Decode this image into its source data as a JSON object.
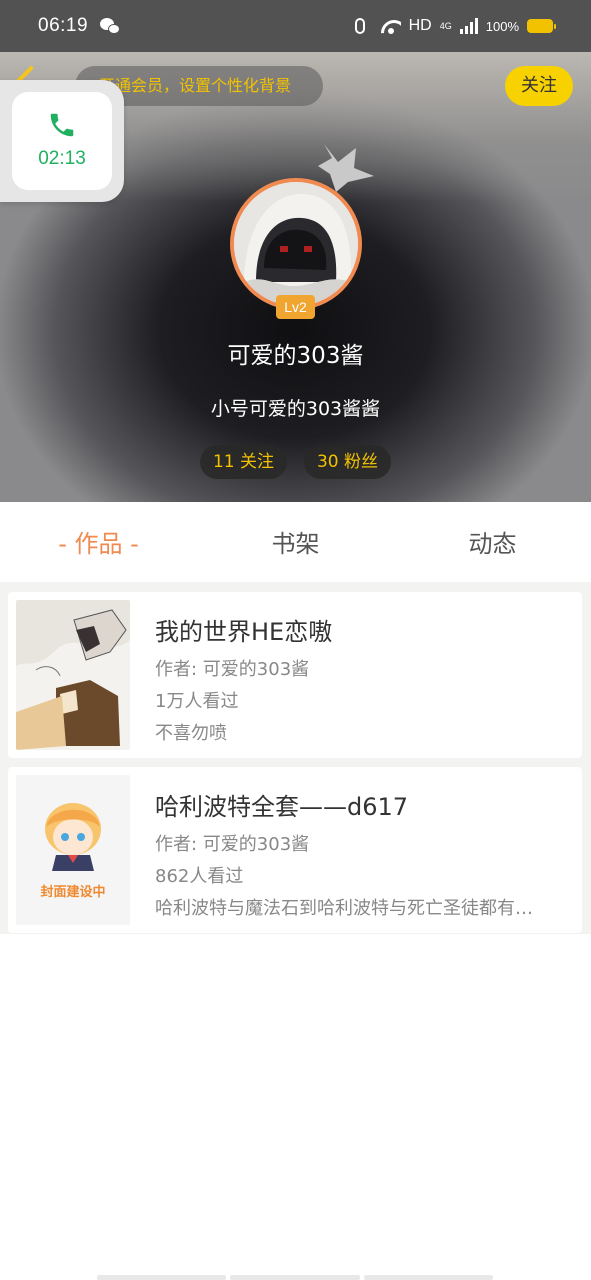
{
  "status_bar": {
    "time": "06:19",
    "network": "HD",
    "signal_type": "4G",
    "battery": "100%",
    "battery_color": "#f2c200"
  },
  "header": {
    "vip_banner": "开通会员，设置个性化背景",
    "follow_label": "关注",
    "accent_color": "#f7d100"
  },
  "call_widget": {
    "timer": "02:13",
    "icon": "phone-icon",
    "color": "#20b060"
  },
  "profile": {
    "level": "Lv2",
    "username": "可爱的303酱",
    "bio": "小号可爱的303酱酱",
    "following": "11 关注",
    "fans": "30 粉丝"
  },
  "tabs": [
    {
      "label": "- 作品 -",
      "active": true
    },
    {
      "label": "书架",
      "active": false
    },
    {
      "label": "动态",
      "active": false
    }
  ],
  "books": [
    {
      "title": "我的世界HE恋嗷",
      "author": "作者: 可爱的303酱",
      "views": "1万人看过",
      "desc": "不喜勿喷"
    },
    {
      "title": "哈利波特全套——d617",
      "author": "作者: 可爱的303酱",
      "views": "862人看过",
      "desc": "哈利波特与魔法石到哈利波特与死亡圣徒都有…",
      "cover_text": "封面建设中"
    }
  ]
}
